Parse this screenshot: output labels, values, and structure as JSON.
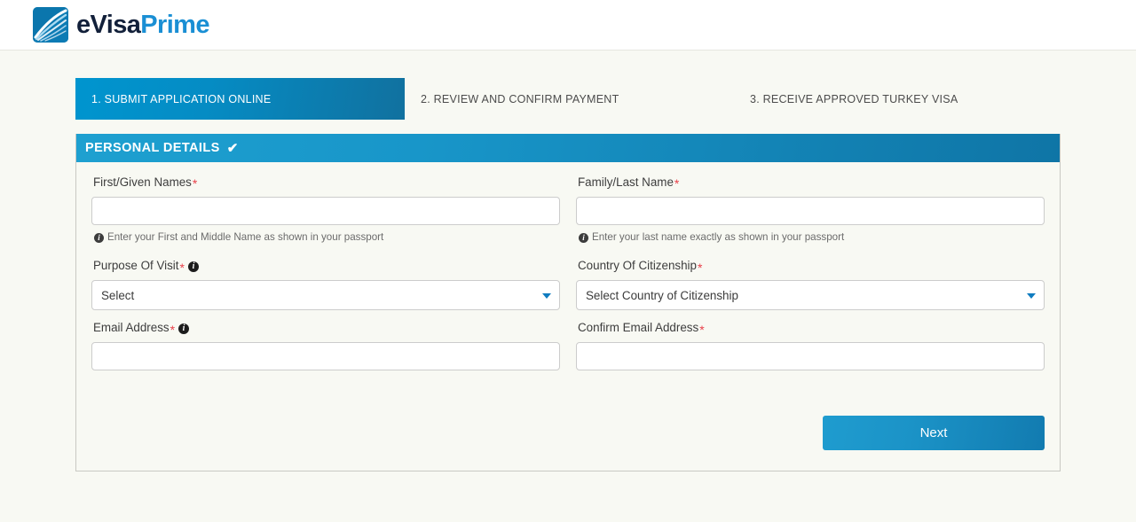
{
  "brand": {
    "name_part1": "eVisa",
    "name_part2": "Prime",
    "logo_icon": "evisaprime-logo-icon"
  },
  "steps": [
    {
      "label": "1. SUBMIT APPLICATION ONLINE",
      "active": true
    },
    {
      "label": "2. REVIEW AND CONFIRM PAYMENT",
      "active": false
    },
    {
      "label": "3. RECEIVE APPROVED TURKEY VISA",
      "active": false
    }
  ],
  "section": {
    "title": "PERSONAL DETAILS",
    "check_icon": "✔"
  },
  "fields": {
    "first_name": {
      "label": "First/Given Names",
      "required_mark": "*",
      "value": "",
      "placeholder": "",
      "hint": "Enter your First and Middle Name as shown in your passport"
    },
    "last_name": {
      "label": "Family/Last Name",
      "required_mark": "*",
      "value": "",
      "placeholder": "",
      "hint": "Enter your last name exactly as shown in your passport"
    },
    "purpose_of_visit": {
      "label": "Purpose Of Visit",
      "required_mark": "*",
      "selected": "Select"
    },
    "country_of_citizenship": {
      "label": "Country Of Citizenship",
      "required_mark": "*",
      "selected": "Select Country of Citizenship"
    },
    "email": {
      "label": "Email Address",
      "required_mark": "*",
      "value": "",
      "placeholder": ""
    },
    "confirm_email": {
      "label": "Confirm Email Address",
      "required_mark": "*",
      "value": "",
      "placeholder": ""
    }
  },
  "footer": {
    "next_label": "Next"
  },
  "colors": {
    "accent_blue": "#0f8ac4",
    "header_dark_blue": "#11719f",
    "required_red": "#e8414a",
    "page_background": "#f8f9f3"
  }
}
